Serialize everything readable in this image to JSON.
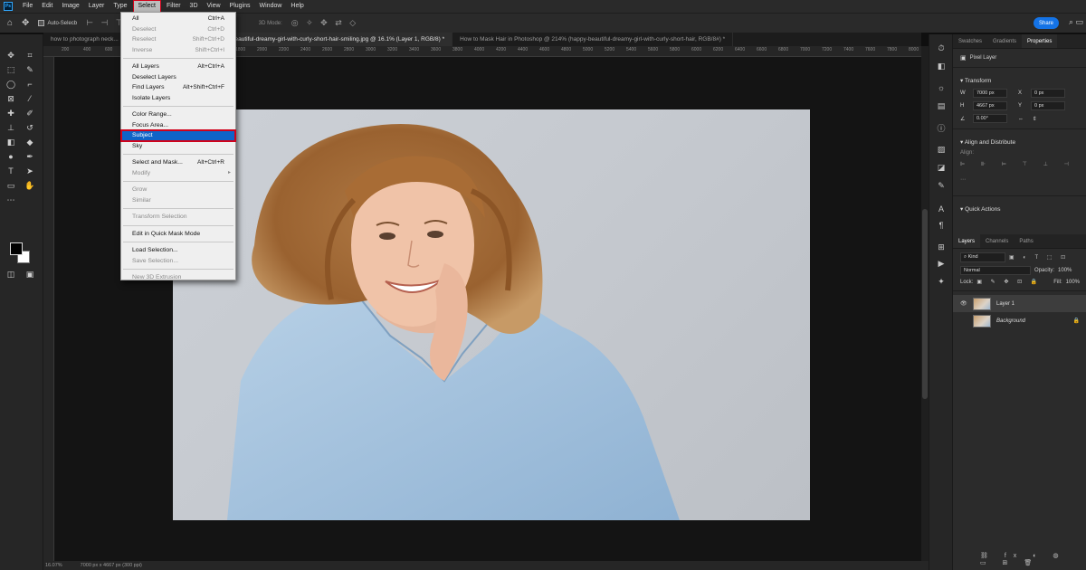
{
  "menubar": {
    "logo": "Ps",
    "items": [
      "File",
      "Edit",
      "Image",
      "Layer",
      "Type",
      "Select",
      "Filter",
      "3D",
      "View",
      "Plugins",
      "Window",
      "Help"
    ],
    "active_index": 5
  },
  "options": {
    "auto_select_label": "Auto-Selecb",
    "mode_label": "3D Mode:",
    "share_label": "Share"
  },
  "tabs": [
    {
      "label": "how to photograph neck...",
      "active": false
    },
    {
      "label": "happy-beautiful-dreamy-girl-with-curly-short-hair-smiling.jpg @ 16.1% (Layer 1, RGB/8) *",
      "active": true
    },
    {
      "label": "How to Mask Hair in Photoshop @ 214% (happy-beautiful-dreamy-girl-with-curly-short-hair, RGB/8#) *",
      "active": false
    }
  ],
  "ruler": [
    "200",
    "400",
    "600",
    "800",
    "1000",
    "1200",
    "1400",
    "1600",
    "1800",
    "2000",
    "2200",
    "2400",
    "2600",
    "2800",
    "3000",
    "3200",
    "3400",
    "3600",
    "3800",
    "4000",
    "4200",
    "4400",
    "4600",
    "4800",
    "5000",
    "5200",
    "5400",
    "5600",
    "5800",
    "6000",
    "6200",
    "6400",
    "6600",
    "6800",
    "7000",
    "7200",
    "7400",
    "7600",
    "7800",
    "8000"
  ],
  "select_menu": {
    "groups": [
      [
        {
          "label": "All",
          "shortcut": "Ctrl+A",
          "disabled": false
        },
        {
          "label": "Deselect",
          "shortcut": "Ctrl+D",
          "disabled": true
        },
        {
          "label": "Reselect",
          "shortcut": "Shift+Ctrl+D",
          "disabled": true
        },
        {
          "label": "Inverse",
          "shortcut": "Shift+Ctrl+I",
          "disabled": true
        }
      ],
      [
        {
          "label": "All Layers",
          "shortcut": "Alt+Ctrl+A",
          "disabled": false
        },
        {
          "label": "Deselect Layers",
          "shortcut": "",
          "disabled": false
        },
        {
          "label": "Find Layers",
          "shortcut": "Alt+Shift+Ctrl+F",
          "disabled": false
        },
        {
          "label": "Isolate Layers",
          "shortcut": "",
          "disabled": false
        }
      ],
      [
        {
          "label": "Color Range...",
          "shortcut": "",
          "disabled": false
        },
        {
          "label": "Focus Area...",
          "shortcut": "",
          "disabled": false
        },
        {
          "label": "Subject",
          "shortcut": "",
          "disabled": false,
          "highlight": true
        },
        {
          "label": "Sky",
          "shortcut": "",
          "disabled": false
        }
      ],
      [
        {
          "label": "Select and Mask...",
          "shortcut": "Alt+Ctrl+R",
          "disabled": false
        },
        {
          "label": "Modify",
          "shortcut": "",
          "disabled": true,
          "submenu": true
        }
      ],
      [
        {
          "label": "Grow",
          "shortcut": "",
          "disabled": true
        },
        {
          "label": "Similar",
          "shortcut": "",
          "disabled": true
        }
      ],
      [
        {
          "label": "Transform Selection",
          "shortcut": "",
          "disabled": true
        }
      ],
      [
        {
          "label": "Edit in Quick Mask Mode",
          "shortcut": "",
          "disabled": false
        }
      ],
      [
        {
          "label": "Load Selection...",
          "shortcut": "",
          "disabled": false
        },
        {
          "label": "Save Selection...",
          "shortcut": "",
          "disabled": true
        }
      ],
      [
        {
          "label": "New 3D Extrusion",
          "shortcut": "",
          "disabled": true
        }
      ]
    ]
  },
  "panel": {
    "top_tabs": [
      "Swatches",
      "Gradients",
      "Properties"
    ],
    "pixel_layer": "Pixel Layer",
    "transform_title": "Transform",
    "w_label": "W",
    "w_value": "7000 px",
    "h_label": "H",
    "h_value": "4667 px",
    "x_label": "X",
    "x_value": "0 px",
    "y_label": "Y",
    "y_value": "0 px",
    "angle_value": "0.00°",
    "align_title": "Align and Distribute",
    "align_label": "Align:",
    "quick_actions_title": "Quick Actions",
    "layer_tabs": [
      "Layers",
      "Channels",
      "Paths"
    ],
    "kind_label": "Kind",
    "blend_mode": "Normal",
    "opacity_label": "Opacity:",
    "opacity_value": "100%",
    "lock_label": "Lock:",
    "fill_label": "Fill:",
    "fill_value": "100%",
    "layers": [
      {
        "name": "Layer 1",
        "selected": true
      },
      {
        "name": "Background",
        "selected": false
      }
    ]
  },
  "status": {
    "zoom": "16.07%",
    "doc_info": "7000 px x 4667 px (300 ppi)"
  },
  "colors": {
    "accent": "#1473e6",
    "highlight_outline": "#d0021b",
    "menu_highlight": "#0f64c8"
  }
}
